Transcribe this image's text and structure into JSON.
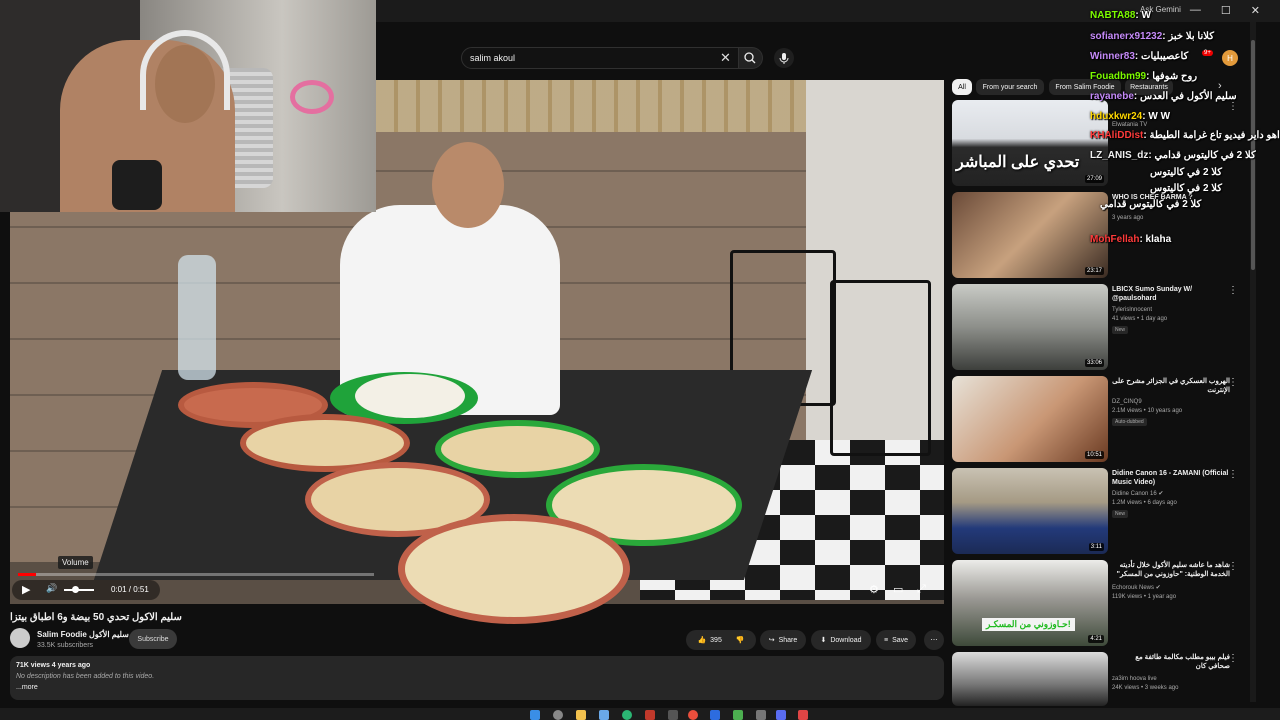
{
  "window": {
    "ask_gemini": "Ask Gemini",
    "minimize": "—",
    "maximize": "☐",
    "close": "✕"
  },
  "search": {
    "query": "salim akoul",
    "clear_icon": "✕",
    "search_icon": "⚲",
    "mic_icon": "🎤"
  },
  "header": {
    "notif_count": "9+",
    "account_initial": "H"
  },
  "player": {
    "volume_tooltip": "Volume",
    "time": "0:01 / 0:51",
    "progress_fraction": 0.05,
    "play_icon": "▶",
    "volume_icon": "🔊",
    "settings_icon": "⚙",
    "miniplayer_icon": "▭",
    "fullscreen_icon": "⤢"
  },
  "video": {
    "title": "سليم الاكول تحدي 50 بيضة و6 اطباق بيتزا",
    "channel_name": "Salim Foodie سليم الأكول",
    "subscribers": "33.5K subscribers",
    "subscribe_label": "Subscribe",
    "likes": "395",
    "share_label": "Share",
    "download_label": "Download",
    "save_label": "Save",
    "more_icon": "⋯"
  },
  "description": {
    "meta": "71K views  4 years ago",
    "text": "No description has been added to this video.",
    "more": "...more"
  },
  "chips": [
    "All",
    "From your search",
    "From Salim Foodie",
    "Restaurants"
  ],
  "recommendations": [
    {
      "title": "",
      "channel": "Elwatania TV",
      "meta": "",
      "duration": "27:09",
      "thumb_text": "تحدي على المباشر"
    },
    {
      "title": "WHO IS CHEF BARMA ?",
      "channel": "",
      "meta": "3 years ago",
      "duration": "23:17",
      "thumb_text": ""
    },
    {
      "title": "LBICX Sumo Sunday W/ @paulsohard",
      "channel": "Tylerislnnocent",
      "meta": "41 views • 1 day ago",
      "badge": "New",
      "duration": "33:06"
    },
    {
      "title": "الهروب العسكري في الجزائر مشرح على الإنترنت",
      "channel": "DZ_CINQ9",
      "meta": "2.1M views • 10 years ago",
      "badge": "Auto-dubbed",
      "duration": "10:51"
    },
    {
      "title": "Didine Canon 16 - ZAMANI (Official Music Video)",
      "channel": "Didine Canon 16 ✔",
      "meta": "1.2M views • 6 days ago",
      "badge": "New",
      "duration": "3:11"
    },
    {
      "title": "شاهد ما عاشه سليم الأكول خلال تأديته الخدمة الوطنية: \"حاوزوني من المسكر\"",
      "channel": "Echorouk News ✔",
      "meta": "119K views • 1 year ago",
      "duration": "4:21",
      "thumb_text": "حـاوزوني من المسكـر!"
    },
    {
      "title": "فيلم بيبو مطلب مكالمة طائفة مع صحافي كان",
      "channel": "za3im hoova live",
      "meta": "24K views • 3 weeks ago",
      "duration": ""
    }
  ],
  "chat": [
    {
      "user": "NABTA88",
      "msg": ": W",
      "color": "#7CFC00"
    },
    {
      "user": "sofianerx91232",
      "msg": ": كلانا بلا خبز",
      "color": "#c58af9"
    },
    {
      "user": "Winner83",
      "msg": ": كاعصيبليات",
      "color": "#c58af9"
    },
    {
      "user": "Fouadbm99",
      "msg": ": روح شوفها",
      "color": "#7CFC00"
    },
    {
      "user": "rayanebe",
      "msg": ": سليم الأكول في العدس",
      "color": "#c58af9"
    },
    {
      "user": "hduxkwr24",
      "msg": ": W W",
      "color": "#FFD700"
    },
    {
      "user": "KHAliDDist",
      "msg": ": اهو داير فيديو تاع غرامة الطيطة",
      "color": "#ff3b3b"
    },
    {
      "user": "LZ_ANIS_dz",
      "msg": ": كلا 2 في كاليتوس قدامي",
      "color": "#f1f1f1"
    },
    {
      "user": "",
      "msg": "كلا 2 في كاليتوس",
      "color": "#f1f1f1"
    },
    {
      "user": "",
      "msg": "كلا 2 في كاليتوس",
      "color": "#f1f1f1"
    },
    {
      "user": "",
      "msg": "كلا 2 في كاليتوس قدامي",
      "color": "#f1f1f1"
    },
    {
      "user": "MohFellah",
      "msg": ": klaha",
      "color": "#ff3b3b"
    }
  ],
  "colors": {
    "youtube_red": "#ff0000",
    "background": "#0f0f0f",
    "chip_bg": "#272727"
  }
}
